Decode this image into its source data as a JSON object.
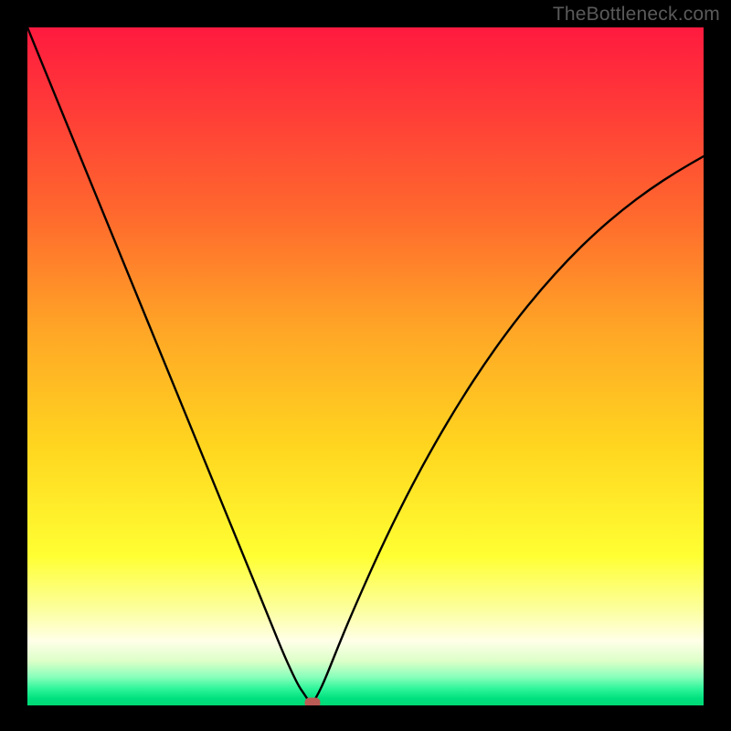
{
  "watermark": "TheBottleneck.com",
  "colors": {
    "frame": "#000000",
    "curve": "#000000",
    "marker": "#bb5b55",
    "gradient_stops": [
      {
        "offset": 0.0,
        "color": "#ff1a3f"
      },
      {
        "offset": 0.12,
        "color": "#ff3b38"
      },
      {
        "offset": 0.28,
        "color": "#ff6a2d"
      },
      {
        "offset": 0.45,
        "color": "#ffa726"
      },
      {
        "offset": 0.62,
        "color": "#ffd61f"
      },
      {
        "offset": 0.78,
        "color": "#ffff33"
      },
      {
        "offset": 0.86,
        "color": "#fcffa0"
      },
      {
        "offset": 0.905,
        "color": "#ffffe8"
      },
      {
        "offset": 0.935,
        "color": "#dcffc8"
      },
      {
        "offset": 0.958,
        "color": "#88ffbb"
      },
      {
        "offset": 0.975,
        "color": "#30f59a"
      },
      {
        "offset": 0.99,
        "color": "#00e07e"
      },
      {
        "offset": 1.0,
        "color": "#00d874"
      }
    ]
  },
  "chart_data": {
    "type": "line",
    "title": "",
    "xlabel": "",
    "ylabel": "",
    "xlim": [
      0,
      100
    ],
    "ylim": [
      0,
      100
    ],
    "grid": false,
    "notes": "V-shaped bottleneck curve on a red→green vertical gradient. Left branch descends steeply from top-left to minimum near x≈42; right branch rises concavely toward top-right. A small rounded marker sits at the minimum on the baseline.",
    "series": [
      {
        "name": "bottleneck-curve",
        "x": [
          0,
          4,
          8,
          12,
          16,
          20,
          24,
          28,
          32,
          36,
          38,
          40,
          41,
          42,
          43,
          44,
          46,
          48,
          52,
          56,
          60,
          64,
          68,
          72,
          76,
          80,
          84,
          88,
          92,
          96,
          100
        ],
        "y": [
          100,
          90.2,
          80.5,
          70.7,
          61.0,
          51.2,
          41.5,
          31.7,
          22.0,
          12.2,
          7.3,
          3.0,
          1.6,
          0.0,
          1.7,
          3.8,
          8.8,
          13.6,
          22.6,
          30.8,
          38.2,
          44.9,
          51.0,
          56.5,
          61.4,
          65.8,
          69.7,
          73.1,
          76.1,
          78.7,
          81.0
        ]
      }
    ],
    "marker": {
      "x": 42.2,
      "y": 0.0
    }
  }
}
